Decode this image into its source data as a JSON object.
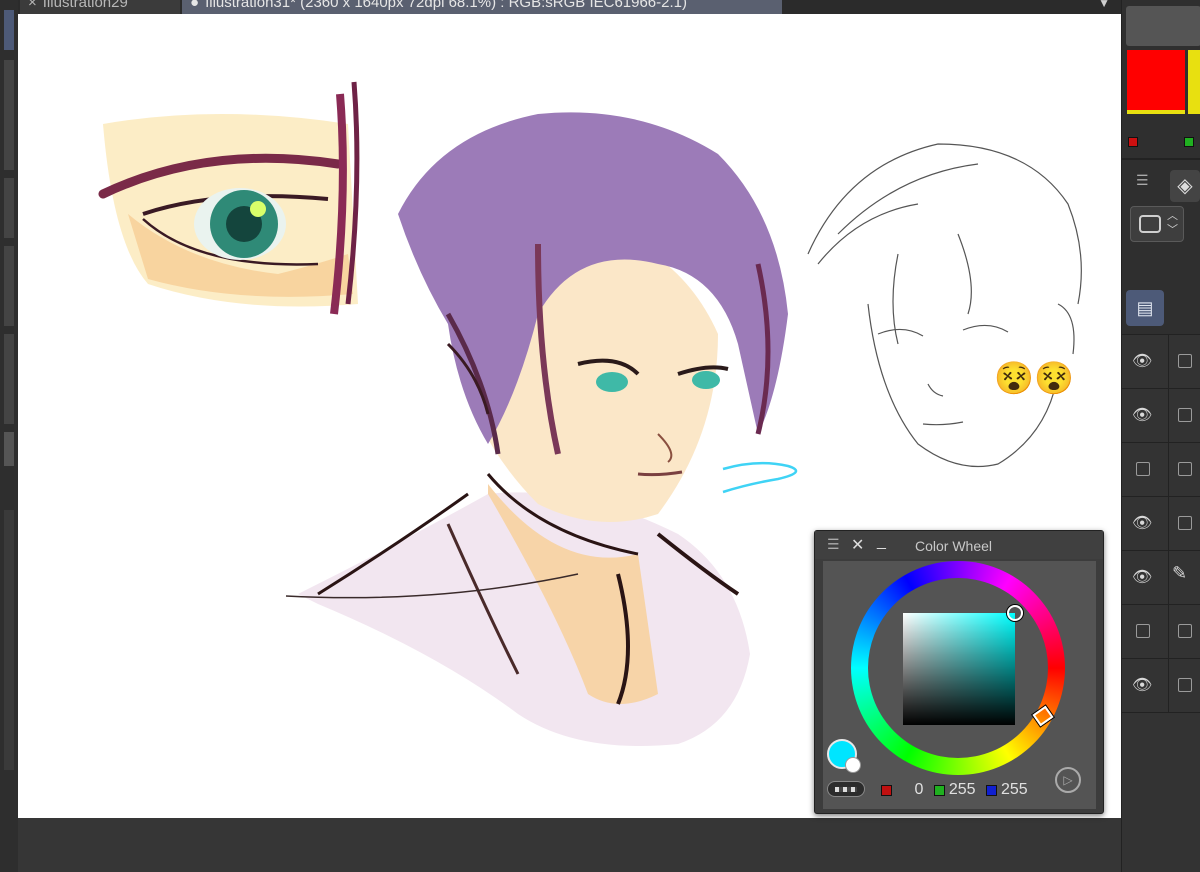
{
  "tabs": [
    {
      "label": "Illustration29",
      "close_icon": "×",
      "active": false
    },
    {
      "label": "Illustration31* (2360 x 1640px 72dpi 68.1%) : RGB:sRGB IEC61966-2.1)",
      "active": true
    }
  ],
  "color_wheel": {
    "title": "Color Wheel",
    "selected_color": "#00e5ff",
    "sub_color": "#ffffff",
    "r": "0",
    "g": "255",
    "b": "255"
  },
  "palette": {
    "main_color": "#ff0000",
    "sub_color": "#e8e010"
  },
  "layers": [
    {
      "visible": true,
      "edit": false
    },
    {
      "visible": true,
      "edit": false
    },
    {
      "visible": false,
      "edit": false
    },
    {
      "visible": true,
      "edit": false
    },
    {
      "visible": true,
      "edit": true
    },
    {
      "visible": false,
      "edit": false
    },
    {
      "visible": true,
      "edit": false
    }
  ],
  "canvas": {
    "sticker_left": "😵",
    "sticker_right": "😵"
  }
}
